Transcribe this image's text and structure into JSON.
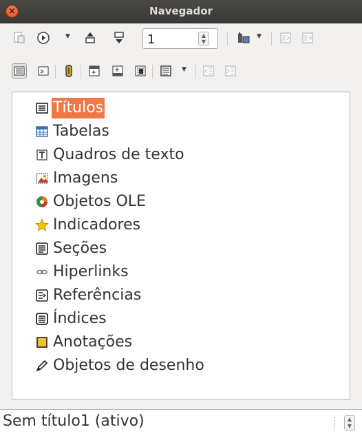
{
  "window": {
    "title": "Navegador",
    "close_icon": "close-icon"
  },
  "toolbar1": {
    "page_number": "1",
    "icons": [
      "toggle-icon",
      "navigation-icon",
      "previous-icon",
      "next-icon",
      "drag-mode-icon",
      "promote-icon",
      "demote-icon"
    ]
  },
  "toolbar2": {
    "icons": [
      "list-box-icon",
      "content-view-icon",
      "reminder-icon",
      "header-icon",
      "footer-icon",
      "anchor-icon",
      "heading-levels-icon",
      "outline-left-icon",
      "outline-right-icon"
    ]
  },
  "categories": [
    {
      "label": "Títulos",
      "icon": "headings-icon",
      "selected": true
    },
    {
      "label": "Tabelas",
      "icon": "table-icon",
      "selected": false
    },
    {
      "label": "Quadros de texto",
      "icon": "text-frame-icon",
      "selected": false
    },
    {
      "label": "Imagens",
      "icon": "image-icon",
      "selected": false
    },
    {
      "label": "Objetos OLE",
      "icon": "ole-object-icon",
      "selected": false
    },
    {
      "label": "Indicadores",
      "icon": "bookmark-star-icon",
      "selected": false
    },
    {
      "label": "Seções",
      "icon": "section-icon",
      "selected": false
    },
    {
      "label": "Hiperlinks",
      "icon": "hyperlink-icon",
      "selected": false
    },
    {
      "label": "Referências",
      "icon": "reference-icon",
      "selected": false
    },
    {
      "label": "Índices",
      "icon": "index-icon",
      "selected": false
    },
    {
      "label": "Anotações",
      "icon": "annotation-icon",
      "selected": false
    },
    {
      "label": "Objetos de desenho",
      "icon": "drawing-object-icon",
      "selected": false
    }
  ],
  "document_selector": {
    "value": "Sem título1 (ativo)"
  },
  "colors": {
    "selection": "#f07746",
    "titlebar": "#3e3d39"
  }
}
